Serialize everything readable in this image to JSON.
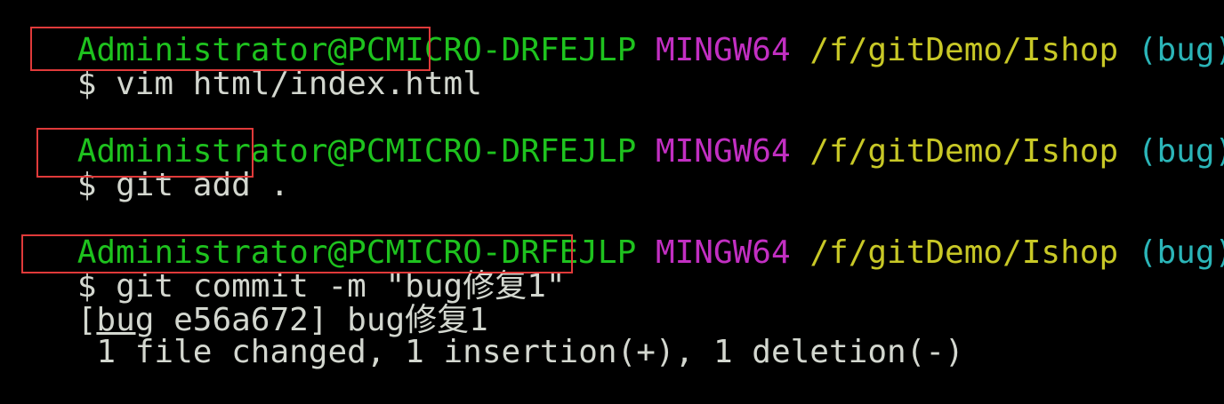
{
  "prompts": [
    {
      "user": "Administrator@PCMICRO-DRFEJLP",
      "env": "MINGW64",
      "path": "/f/gitDemo/Ishop",
      "branch": "(bug)",
      "symbol": "$",
      "command": "vim html/index.html"
    },
    {
      "user": "Administrator@PCMICRO-DRFEJLP",
      "env": "MINGW64",
      "path": "/f/gitDemo/Ishop",
      "branch": "(bug)",
      "symbol": "$",
      "command": "git add ."
    },
    {
      "user": "Administrator@PCMICRO-DRFEJLP",
      "env": "MINGW64",
      "path": "/f/gitDemo/Ishop",
      "branch": "(bug)",
      "symbol": "$",
      "command": "git commit -m \"bug修复1\""
    }
  ],
  "output": {
    "commit_open": "[",
    "commit_branch": "bug",
    "commit_rest": " e56a672] bug修复1",
    "stats": " 1 file changed, 1 insertion(+), 1 deletion(-)"
  },
  "colors": {
    "user": "#1ec21e",
    "env": "#c22fc2",
    "path": "#c8c826",
    "branch": "#2bb5b8",
    "text": "#d3d7cf",
    "highlight_box": "#e03a3a",
    "background": "#000000"
  }
}
